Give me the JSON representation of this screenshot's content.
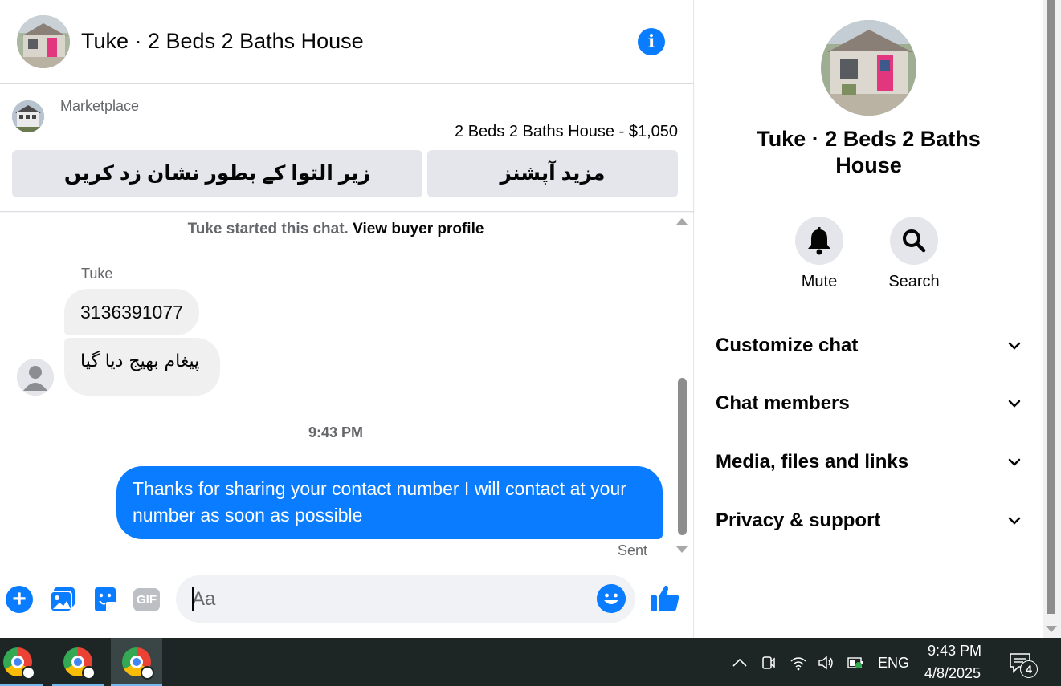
{
  "chat": {
    "title": "Tuke · 2 Beds 2 Baths House",
    "marketplace_label": "Marketplace",
    "listing": "2 Beds 2 Baths House - $1,050",
    "mark_button": "زیر التوا کے بطور نشان زد کریں",
    "options_button": "مزید آپشنز",
    "started_text": "Tuke started this chat.",
    "buyer_profile_link": "View buyer profile",
    "sender_name": "Tuke",
    "incoming": [
      "3136391077",
      "پیغام بھیج دیا گیا"
    ],
    "timestamp": "9:43 PM",
    "outgoing": "Thanks for sharing your contact number I will contact at your number as soon as possible",
    "status": "Sent",
    "input_placeholder": "Aa"
  },
  "panel": {
    "title": "Tuke · 2 Beds 2 Baths House",
    "actions": [
      {
        "label": "Mute",
        "icon": "bell-icon"
      },
      {
        "label": "Search",
        "icon": "search-icon"
      }
    ],
    "menu": [
      "Customize chat",
      "Chat members",
      "Media, files and links",
      "Privacy & support"
    ]
  },
  "taskbar": {
    "language": "ENG",
    "time": "9:43 PM",
    "date": "4/8/2025",
    "notification_count": "4"
  },
  "colors": {
    "accent": "#0a7cff",
    "incoming_bubble": "#f0f0f0",
    "button_bg": "#e4e6eb",
    "taskbar": "#1d2525"
  }
}
